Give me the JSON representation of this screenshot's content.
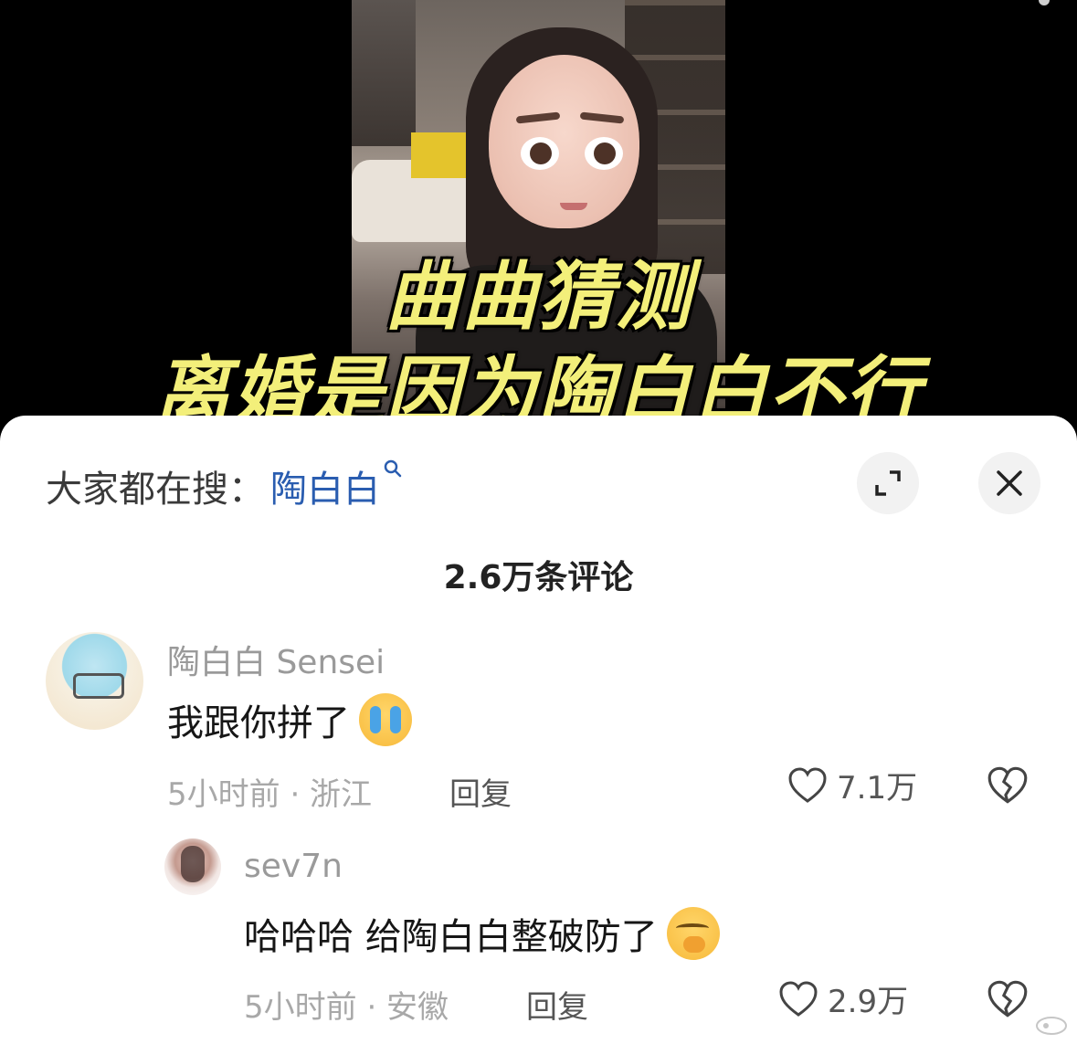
{
  "video": {
    "caption_line1": "曲曲猜测",
    "caption_line2": "离婚是因为陶白白不行"
  },
  "sheet": {
    "search_prefix": "大家都在搜：",
    "search_term": "陶白白",
    "count_label": "2.6万条评论"
  },
  "comments": [
    {
      "username": "陶白白 Sensei",
      "text": "我跟你拼了",
      "emoji": "crying-face-emoji",
      "time_location": "5小时前 · 浙江",
      "reply_label": "回复",
      "likes": "7.1万"
    },
    {
      "username": "sev7n",
      "text": "哈哈哈 给陶白白整破防了",
      "emoji": "giggle-face-emoji",
      "time_location": "5小时前 · 安徽",
      "reply_label": "回复",
      "likes": "2.9万"
    }
  ],
  "icons": {
    "expand": "expand-icon",
    "close": "close-icon",
    "like": "heart-icon",
    "dislike": "broken-heart-icon",
    "search": "search-icon"
  },
  "colors": {
    "caption": "#f3ef7a",
    "link": "#2a5db0",
    "muted": "#a8a8a8"
  }
}
